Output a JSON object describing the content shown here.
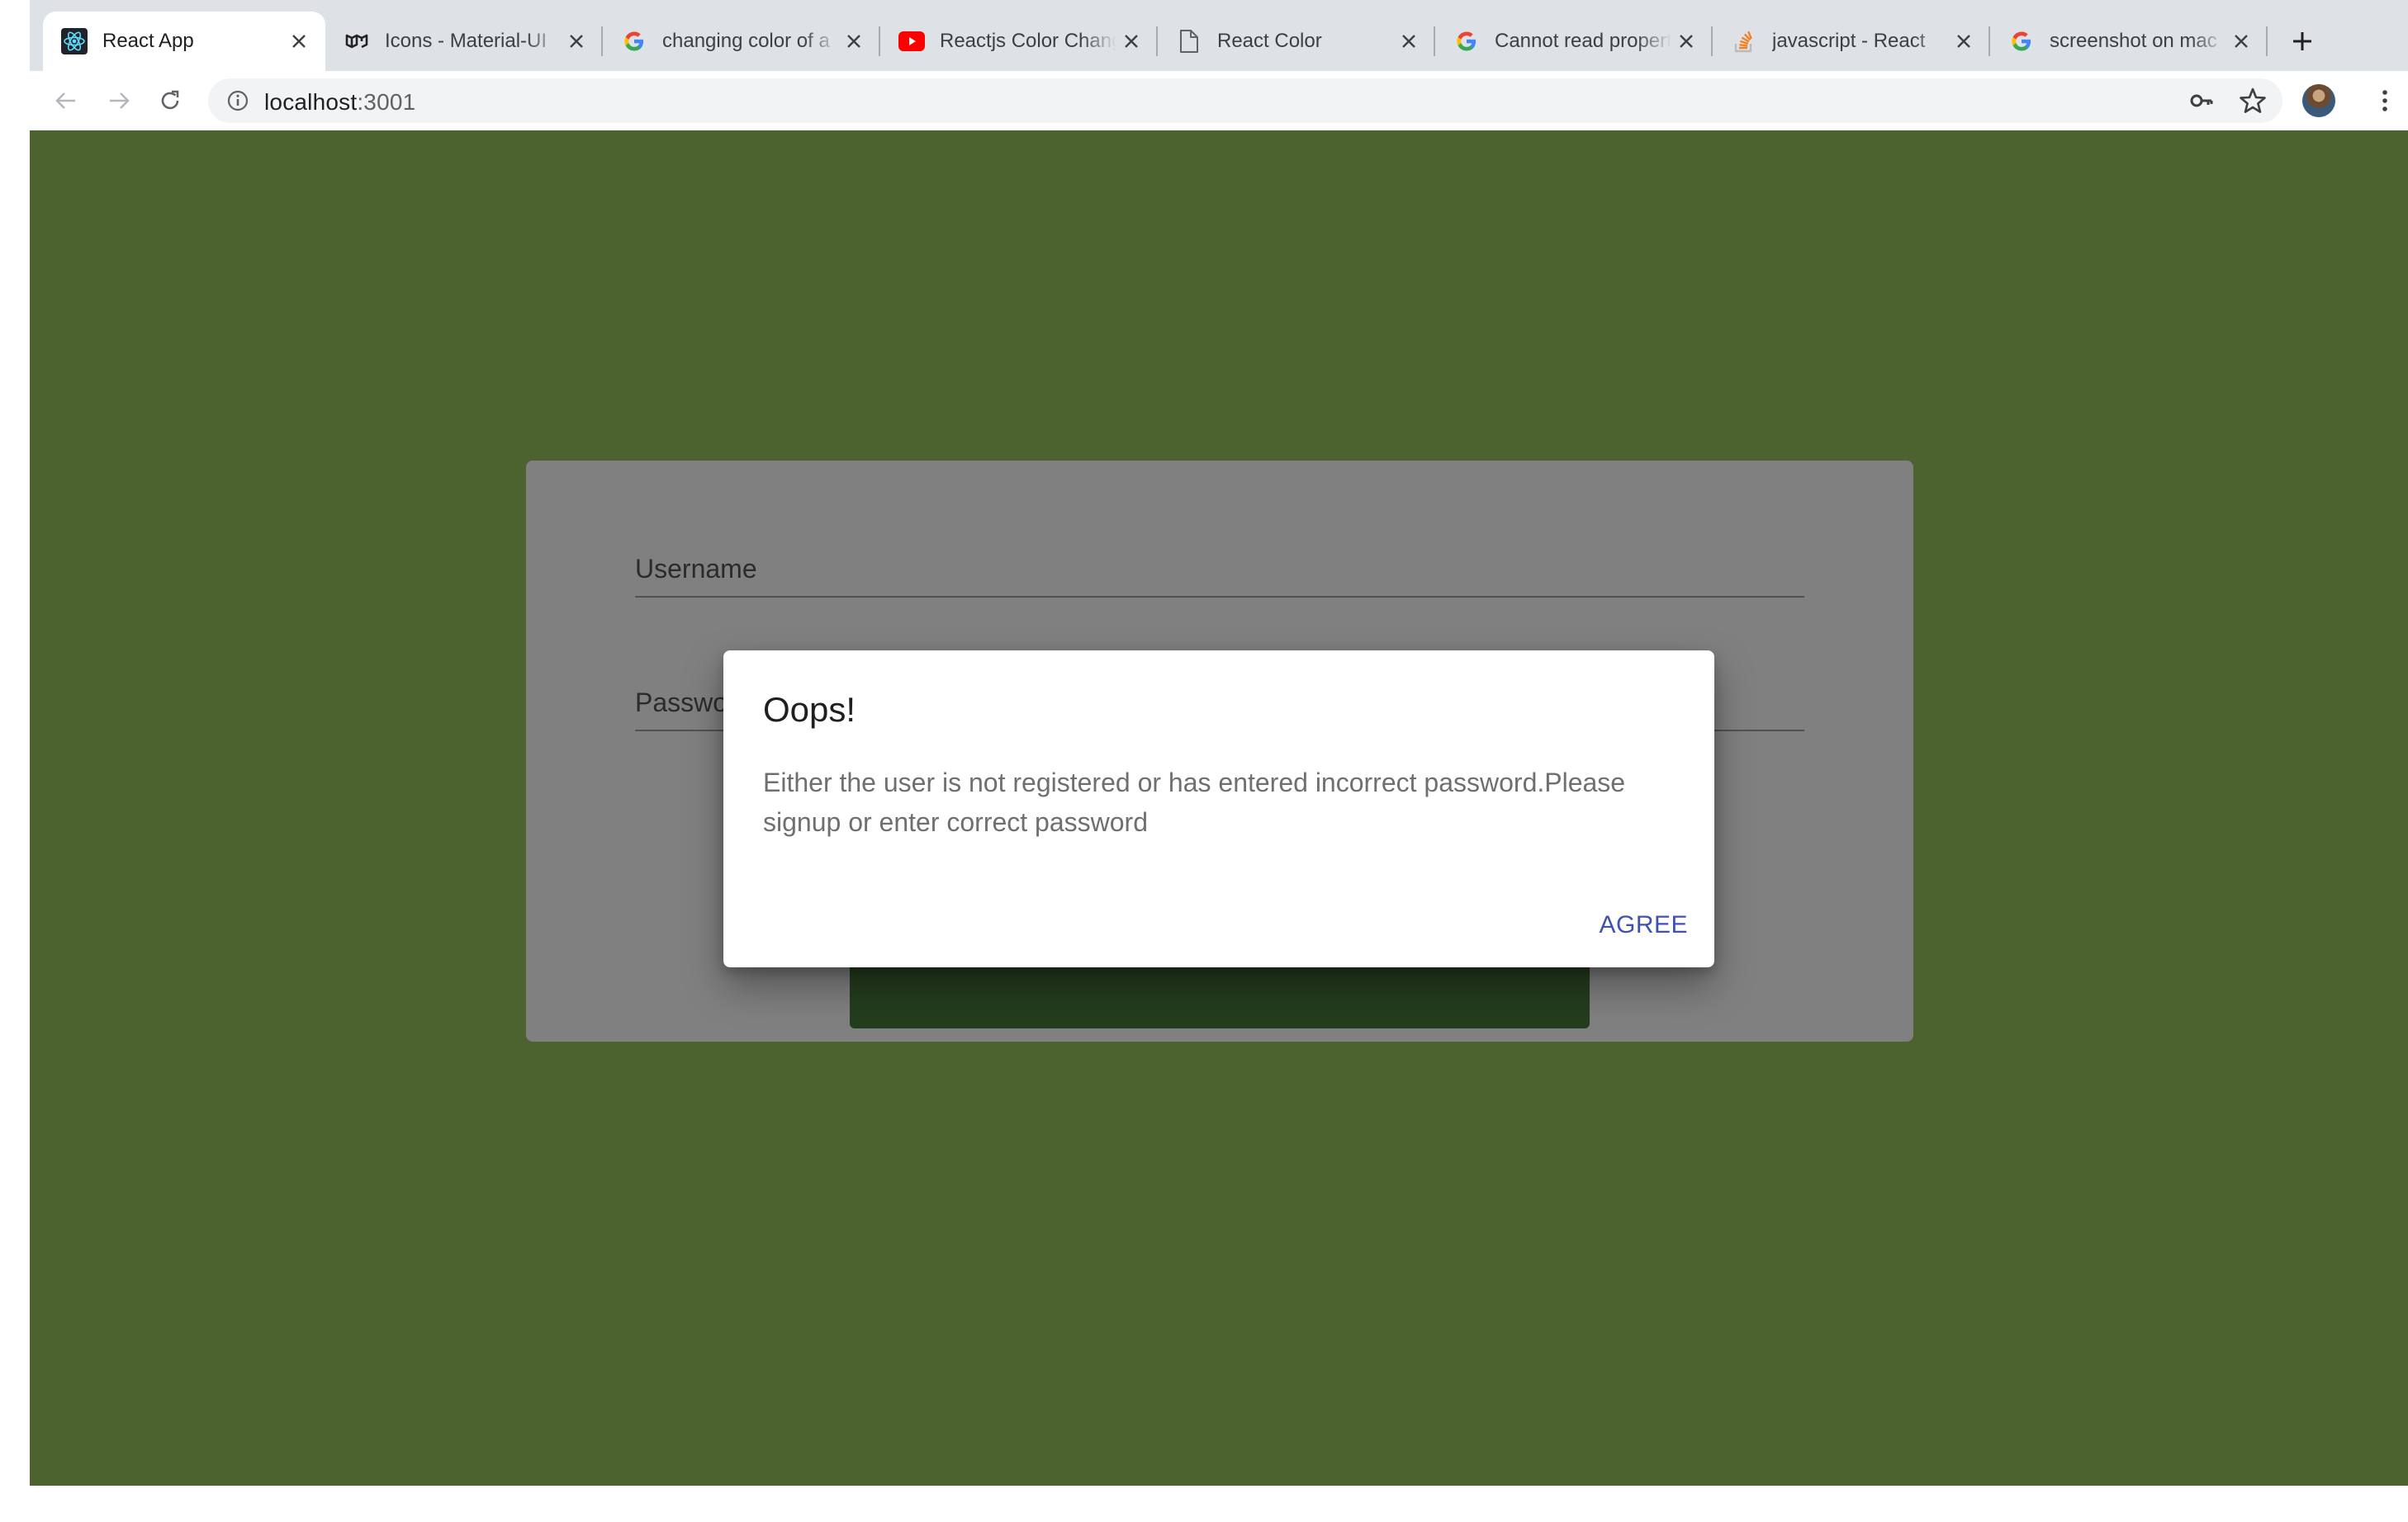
{
  "browser": {
    "tabs": [
      {
        "title": "React App",
        "favicon": "react-logo-icon",
        "active": true
      },
      {
        "title": "Icons - Material-UI",
        "favicon": "material-ui-logo-icon",
        "active": false
      },
      {
        "title": "changing color of a",
        "favicon": "google-logo-icon",
        "active": false
      },
      {
        "title": "Reactjs Color Change",
        "favicon": "youtube-logo-icon",
        "active": false
      },
      {
        "title": "React Color",
        "favicon": "document-icon",
        "active": false
      },
      {
        "title": "Cannot read property",
        "favicon": "google-logo-icon",
        "active": false
      },
      {
        "title": "javascript - React",
        "favicon": "stackoverflow-logo-icon",
        "active": false
      },
      {
        "title": "screenshot on mac",
        "favicon": "google-logo-icon",
        "active": false
      }
    ],
    "address": {
      "host": "localhost",
      "port": ":3001"
    }
  },
  "login_form": {
    "username_label": "Username",
    "password_label": "Password"
  },
  "dialog": {
    "title": "Oops!",
    "message": "Either the user is not registered or has entered incorrect password.Please signup or enter correct password",
    "button_label": "AGREE"
  },
  "colors": {
    "page_background": "#4c6330",
    "card_background": "#808080",
    "dialog_button": "#3f51b5",
    "login_button": "#243d1e"
  }
}
